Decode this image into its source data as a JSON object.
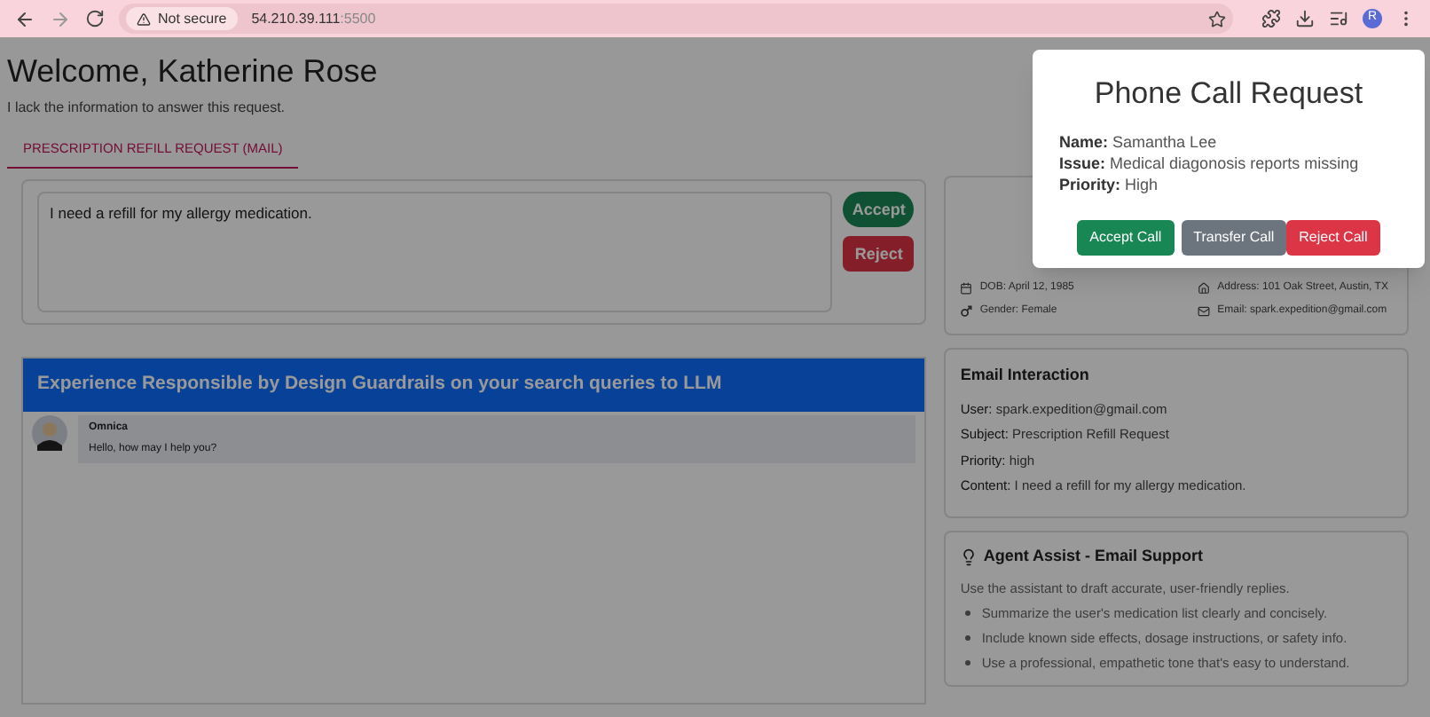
{
  "browser": {
    "security": "Not secure",
    "host": "54.210.39.111",
    "port": ":5500",
    "profile": "R"
  },
  "header": {
    "title": "Welcome, Katherine Rose",
    "subtitle": "I lack the information to answer this request."
  },
  "tabs": [
    {
      "label": "PRESCRIPTION REFILL REQUEST (MAIL)",
      "selected": true
    }
  ],
  "request": {
    "message": "I need a refill for my allergy medication.",
    "buttons": [
      {
        "label": "Accept",
        "kind": "accept"
      },
      {
        "label": "Reject",
        "kind": "reject"
      }
    ]
  },
  "chat": {
    "banner": "Experience Responsible by Design Guardrails on your search queries to LLM",
    "messages": [
      {
        "sender": "Omnica",
        "text": "Hello, how may I help you?"
      }
    ]
  },
  "patient": {
    "fields": [
      {
        "kind": "dob",
        "text": "DOB: April 12, 1985"
      },
      {
        "kind": "address",
        "text": "Address: 101 Oak Street, Austin, TX"
      },
      {
        "kind": "gender",
        "text": "Gender: Female"
      },
      {
        "kind": "email",
        "text": "Email: spark.expedition@gmail.com"
      }
    ]
  },
  "email": {
    "title": "Email Interaction",
    "fields": [
      {
        "label": "User:",
        "value": "spark.expedition@gmail.com"
      },
      {
        "label": "Subject:",
        "value": "Prescription Refill Request"
      },
      {
        "label": "Priority:",
        "value": "high"
      },
      {
        "label": "Content:",
        "value": "I need a refill for my allergy medication."
      }
    ]
  },
  "assist": {
    "title": "Agent Assist - Email Support",
    "intro": "Use the assistant to draft accurate, user-friendly replies.",
    "tips": [
      "Summarize the user's medication list clearly and concisely.",
      "Include known side effects, dosage instructions, or safety info.",
      "Use a professional, empathetic tone that's easy to understand."
    ]
  },
  "modal": {
    "title": "Phone Call Request",
    "fields": [
      {
        "label": "Name:",
        "value": "Samantha Lee"
      },
      {
        "label": "Issue:",
        "value": "Medical diagonosis reports missing"
      },
      {
        "label": "Priority:",
        "value": "High"
      }
    ],
    "buttons": [
      {
        "label": "Accept Call",
        "kind": "accept"
      },
      {
        "label": "Transfer Call",
        "kind": "transfer"
      },
      {
        "label": "Reject Call",
        "kind": "reject"
      }
    ]
  }
}
